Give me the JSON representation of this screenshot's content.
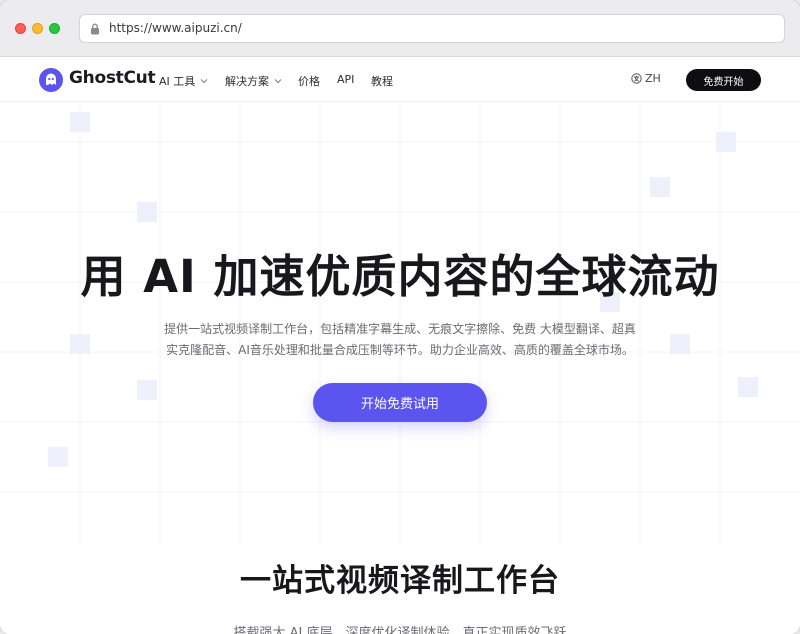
{
  "browser": {
    "url": "https://www.aipuzi.cn/"
  },
  "nav": {
    "logo_text": "GhostCut",
    "items": [
      {
        "label": "AI 工具",
        "dropdown": true
      },
      {
        "label": "解决方案",
        "dropdown": true
      },
      {
        "label": "价格",
        "dropdown": false
      },
      {
        "label": "API",
        "dropdown": false
      },
      {
        "label": "教程",
        "dropdown": false
      }
    ],
    "language": "ZH",
    "signup_label": "免费开始"
  },
  "hero": {
    "title": "用 AI 加速优质内容的全球流动",
    "subtitle_line1": "提供一站式视频译制工作台，包括精准字幕生成、无痕文字擦除、免费 大模型翻译、超真",
    "subtitle_line2": "实克隆配音、AI音乐处理和批量合成压制等环节。助力企业高效、高质的覆盖全球市场。",
    "cta_label": "开始免费试用"
  },
  "section": {
    "title": "一站式视频译制工作台",
    "subtitle": "搭载强大 AI 底层，深度优化译制体验，真正实现质效飞跃"
  },
  "colors": {
    "accent": "#5b54ee",
    "dark_button": "#0d0d12"
  }
}
